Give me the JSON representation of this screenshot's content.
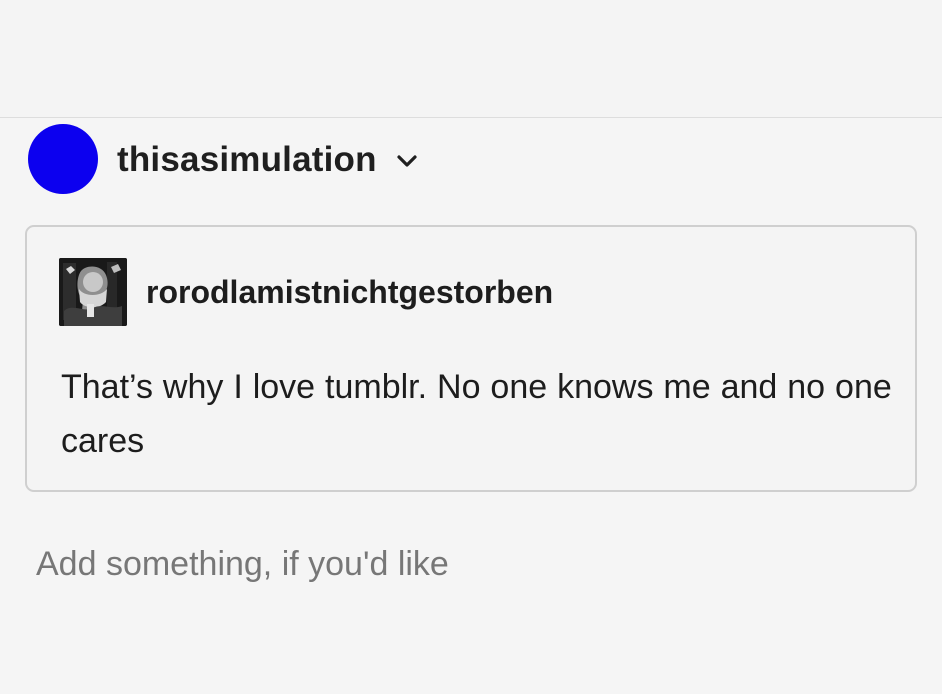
{
  "post": {
    "reblog_blog": {
      "name": "thisasimulation",
      "avatar_color": "#0c00ef",
      "menu_icon": "chevron-down-icon"
    },
    "quoted_post": {
      "username": "rorodlamistnichtgestorben",
      "text": "That’s why I love tumblr. No one knows me and no one cares",
      "avatar_icon": "dark-photo-avatar"
    },
    "reply": {
      "placeholder": "Add something, if you'd like",
      "value": ""
    }
  },
  "colors": {
    "background": "#f4f4f4",
    "text": "#1d1d1d",
    "placeholder": "#777777",
    "border": "#cfcfcf"
  }
}
